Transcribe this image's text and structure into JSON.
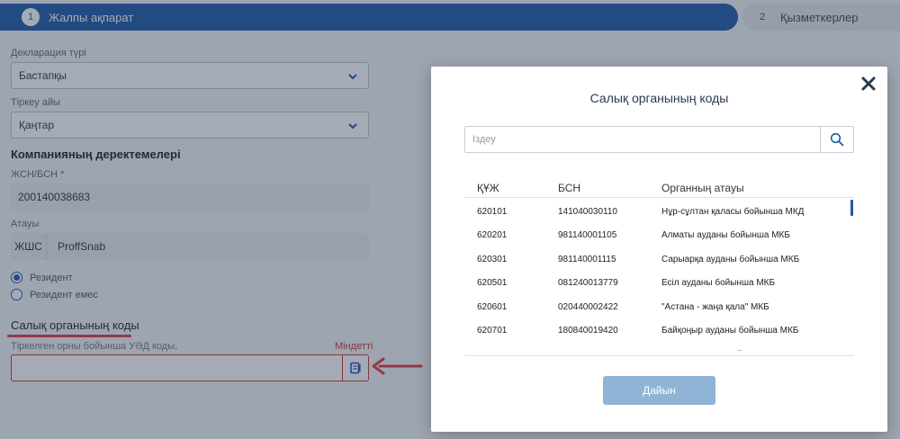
{
  "steps": [
    {
      "num": "1",
      "label": "Жалпы ақпарат"
    },
    {
      "num": "2",
      "label": "Қызметкерлер"
    }
  ],
  "form": {
    "decl_type_label": "Декларация түрі",
    "decl_type_value": "Бастапқы",
    "reg_month_label": "Тіркеу айы",
    "reg_month_value": "Қаңтар",
    "company_section": "Компанияның деректемелері",
    "iin_label": "ЖСН/БСН *",
    "iin_value": "200140038683",
    "name_label": "Атауы",
    "name_prefix": "ЖШС",
    "name_value": "ProffSnab",
    "resident": "Резидент",
    "non_resident": "Резидент емес",
    "tax_section": "Салық органының коды",
    "tax_field_label": "Тіркелген орны бойынша УӘД коды,",
    "required": "Міндетті"
  },
  "modal": {
    "title": "Салық органының коды",
    "search_placeholder": "Іздеу",
    "columns": [
      "ҚҰЖ",
      "БСН",
      "Органның атауы"
    ],
    "rows": [
      {
        "code": "620101",
        "bin": "141040030110",
        "name": "Нұр-сұлтан қаласы бойынша МКД"
      },
      {
        "code": "620201",
        "bin": "981140001105",
        "name": "Алматы ауданы бойынша МКБ"
      },
      {
        "code": "620301",
        "bin": "981140001115",
        "name": "Сарыарқа ауданы бойынша МКБ"
      },
      {
        "code": "620501",
        "bin": "081240013779",
        "name": "Есіл ауданы бойынша МКБ"
      },
      {
        "code": "620601",
        "bin": "020440002422",
        "name": "\"Астана - жаңа қала\" МКБ"
      },
      {
        "code": "620701",
        "bin": "180840019420",
        "name": "Байқоңыр ауданы бойынша МКБ"
      }
    ],
    "ok_label": "Дайын"
  },
  "colors": {
    "primary": "#1e5aa6",
    "error": "#c0392b",
    "annotation": "#e23b3b",
    "button_disabled": "#8fb4d6"
  },
  "icons": [
    "chevron-down-icon",
    "book-icon",
    "close-icon",
    "search-icon",
    "arrow-left-icon"
  ]
}
